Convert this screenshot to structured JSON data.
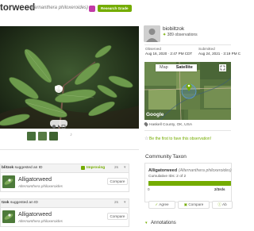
{
  "header": {
    "common_name": "Alligatorweed",
    "title_visible": "torweed",
    "scientific_name": "(Alternanthera philoxeroides)",
    "quality_grade": "Research Grade"
  },
  "photo": {
    "thumbnail_count": 3
  },
  "observer": {
    "username": "biobiltzok",
    "observation_count": "389 observations",
    "observed_label": "Observed",
    "observed_value": "Aug 16, 2020 · 2:47 PM CDT",
    "submitted_label": "Submitted",
    "submitted_value": "Aug 24, 2021 · 3:19 PM C"
  },
  "map": {
    "tab_map": "Map",
    "tab_satellite": "Satellite",
    "google_label": "Google",
    "location": "Haskell County, OK, USA"
  },
  "favorites": {
    "first_fav_text": "Be the first to fave this observation!"
  },
  "identifications": [
    {
      "header_user": "blitzok",
      "header_suffix": " suggested an ID",
      "improving": "Improving",
      "count": "2s",
      "taxon_name": "Alligatorweed",
      "taxon_sci": "Alternanthera philoxeroides",
      "compare_label": "Compare"
    },
    {
      "header_user": "tzok",
      "header_suffix": " suggested an ID",
      "count": "2s",
      "taxon_name": "Alligatorweed",
      "taxon_sci": "Alternanthera philoxeroides",
      "compare_label": "Compare"
    }
  ],
  "community_taxon": {
    "section_title": "Community Taxon",
    "taxon_name": "Alligatorweed",
    "taxon_sci": "(Alternanthera philoxeroides)",
    "cumulative": "Cumulative IDs: 2 of 2",
    "agreement_fraction": 1.0,
    "scale_start": "0",
    "scale_thirds": "2/3rds",
    "agree_label": "Agree",
    "compare_label": "Compare",
    "about_label": "Ab"
  },
  "annotations": {
    "label": "Annotations"
  },
  "colors": {
    "brand_green": "#74ac00",
    "conf_badge": "#c13aa6"
  }
}
